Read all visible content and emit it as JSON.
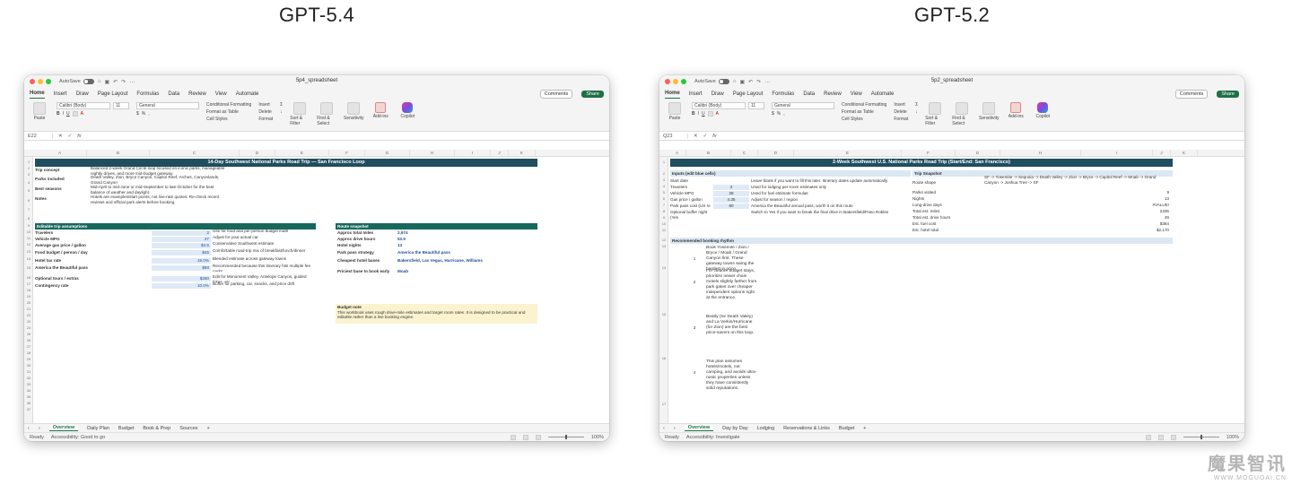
{
  "headings": {
    "left": "GPT-5.4",
    "right": "GPT-5.2"
  },
  "common": {
    "autosave": "AutoSave",
    "ribbon_tabs": [
      "Home",
      "Insert",
      "Draw",
      "Page Layout",
      "Formulas",
      "Data",
      "Review",
      "View",
      "Automate"
    ],
    "comments": "Comments",
    "share": "Share",
    "paste": "Paste",
    "font_name": "Calibri (Body)",
    "font_size": "11",
    "number_format": "General",
    "cond_format": "Conditional Formatting",
    "format_table": "Format as Table",
    "cell_styles": "Cell Styles",
    "insert": "Insert",
    "delete": "Delete",
    "format": "Format",
    "sort_filter": "Sort & Filter",
    "find_select": "Find & Select",
    "sensitivity": "Sensitivity",
    "addins": "Add-ins",
    "copilot": "Copilot",
    "fx": "fx",
    "ready": "Ready",
    "zoom": "100%",
    "plus": "+"
  },
  "left": {
    "doc_title": "5p4_spreadsheet",
    "namebox": "E22",
    "cols": [
      "A",
      "B",
      "C",
      "D",
      "E",
      "F",
      "G",
      "H",
      "I",
      "J",
      "K"
    ],
    "title": "14-Day Southwest National Parks Road Trip — San Francisco Loop",
    "info": [
      {
        "label": "Trip concept",
        "text": "Balanced 2-week Grand Circle loop focused on iconic parks, manageable nightly drives, and more mid-budget gateway."
      },
      {
        "label": "Parks included",
        "text": "Death Valley, Zion, Bryce Canyon, Capitol Reef, Arches, Canyonlands, Grand Canyon"
      },
      {
        "label": "Best seasons",
        "text": "Mid-April to mid-June or mid-September to late-October for the best balance of weather and daylight."
      },
      {
        "label": "Notes",
        "text": "Hotels are examples/start points, not live-rate quotes. Re-check recent reviews and official park alerts before booking."
      }
    ],
    "assump_title": "Editable trip assumptions",
    "assumptions": [
      {
        "label": "Travelers",
        "value": "2",
        "note": "Use for food and per-person budget math"
      },
      {
        "label": "Vehicle MPG",
        "value": "27",
        "note": "Adjust for your actual car"
      },
      {
        "label": "Average gas price / gallon",
        "value": "$4.5",
        "note": "Conservative Southwest estimate"
      },
      {
        "label": "Food budget / person / day",
        "value": "$45",
        "note": "Comfortable road-trip mix of breakfast/lunch/dinner"
      },
      {
        "label": "Hotel tax rate",
        "value": "15.0%",
        "note": "Blended estimate across gateway towns"
      },
      {
        "label": "America the Beautiful pass",
        "value": "$80",
        "note": "Recommended because this itinerary hits multiple fee parks"
      },
      {
        "label": "Optional tours / extras",
        "value": "$250",
        "note": "Edit for Monument Valley, Antelope Canyon, guided hikes, etc."
      },
      {
        "label": "Contingency rate",
        "value": "10.0%",
        "note": "Buffer for parking, car, snacks, and price drift"
      }
    ],
    "route_title": "Route snapshot",
    "route": [
      {
        "label": "Approx total miles",
        "value": "2,674"
      },
      {
        "label": "Approx drive hours",
        "value": "53.5"
      },
      {
        "label": "Hotel nights",
        "value": "13"
      },
      {
        "label": "Park pass strategy",
        "value": "America the Beautiful pass"
      },
      {
        "label": "Cheapest hotel bases",
        "value": "Bakersfield, Las Vegas, Hurricane, Williams"
      },
      {
        "label": "Priciest base to book early",
        "value": "Moab"
      }
    ],
    "budget_note_title": "Budget note",
    "budget_note": "This workbook uses rough drive-mile estimates and target room rates. It is designed to be practical and editable rather than a live booking engine.",
    "sheet_tabs": [
      "Overview",
      "Daily Plan",
      "Budget",
      "Book & Prep",
      "Sources"
    ],
    "accessibility": "Accessibility: Good to go"
  },
  "right": {
    "doc_title": "5p2_spreadsheet",
    "namebox": "Q23",
    "cols": [
      "A",
      "B",
      "C",
      "D",
      "E",
      "F",
      "G",
      "H",
      "I",
      "J",
      "K"
    ],
    "title": "2-Week Southwest U.S. National Parks Road Trip (Start/End: San Francisco)",
    "inputs_title": "Inputs (edit blue cells)",
    "inputs": [
      {
        "label": "Start date",
        "value": "",
        "note": "Leave blank if you want to fill this later. Itinerary dates update automatically."
      },
      {
        "label": "Travelers",
        "value": "2",
        "note": "Used for lodging per-room estimates only"
      },
      {
        "label": "Vehicle MPG",
        "value": "28",
        "note": "Used for fuel estimate formulas"
      },
      {
        "label": "Gas price / gallon",
        "value": "4.35",
        "note": "Adjust for season / region"
      },
      {
        "label": "Park pass cost (US re",
        "value": "80",
        "note": "America the Beautiful annual pass; worth it on this route"
      },
      {
        "label": "Optional buffer night (Yes",
        "value": "",
        "note": "Switch to Yes if you want to break the final drive in Bakersfield/Paso Robles"
      }
    ],
    "snapshot_title": "Trip Snapshot",
    "snapshot": [
      {
        "label": "Route shape",
        "value": "SF -> Yosemite -> Sequoia -> Death Valley -> Zion -> Bryce -> Capitol Reef -> Moab -> Grand Canyon -> Joshua Tree -> SF"
      },
      {
        "label": "Parks visited",
        "value": "9"
      },
      {
        "label": "Nights",
        "value": "13"
      },
      {
        "label": "Long-drive days",
        "value": "#VALUE!"
      },
      {
        "label": "Total est. miles",
        "value": "2335"
      },
      {
        "label": "Total est. drive hours",
        "value": "49"
      },
      {
        "label": "Est. fuel cost",
        "value": "$354"
      },
      {
        "label": "Est. hotel total",
        "value": "$2,170"
      }
    ],
    "booking_title": "Recommended booking rhythm",
    "booking": [
      {
        "n": "1",
        "text": "Book Yosemite / Zion / Bryce / Moab / Grand Canyon first. These gateway towns swing the hardest in price."
      },
      {
        "n": "2",
        "text": "For cleaner budget stays, prioritize newer chain motels slightly farther from park gates over cheaper independent options right at the entrance."
      },
      {
        "n": "3",
        "text": "Beatty (for Death Valley) and La Verkin/Hurricane (for Zion) are the best price-savers on this loop."
      },
      {
        "n": "4",
        "text": "This plan assumes hotels/motels, not camping, and avoids ultra-rustic properties unless they have consistently solid reputations."
      }
    ],
    "sheet_tabs": [
      "Overview",
      "Day by Day",
      "Lodging",
      "Reservations & Links",
      "Budget"
    ],
    "accessibility": "Accessibility: Investigate"
  },
  "watermark": {
    "line1": "魔果智讯",
    "line2": "WWW.MOGUOAI.CN"
  },
  "colors": {
    "accent": "#1e7145",
    "title_bar": "#1f4e5f",
    "section": "#17685c"
  }
}
